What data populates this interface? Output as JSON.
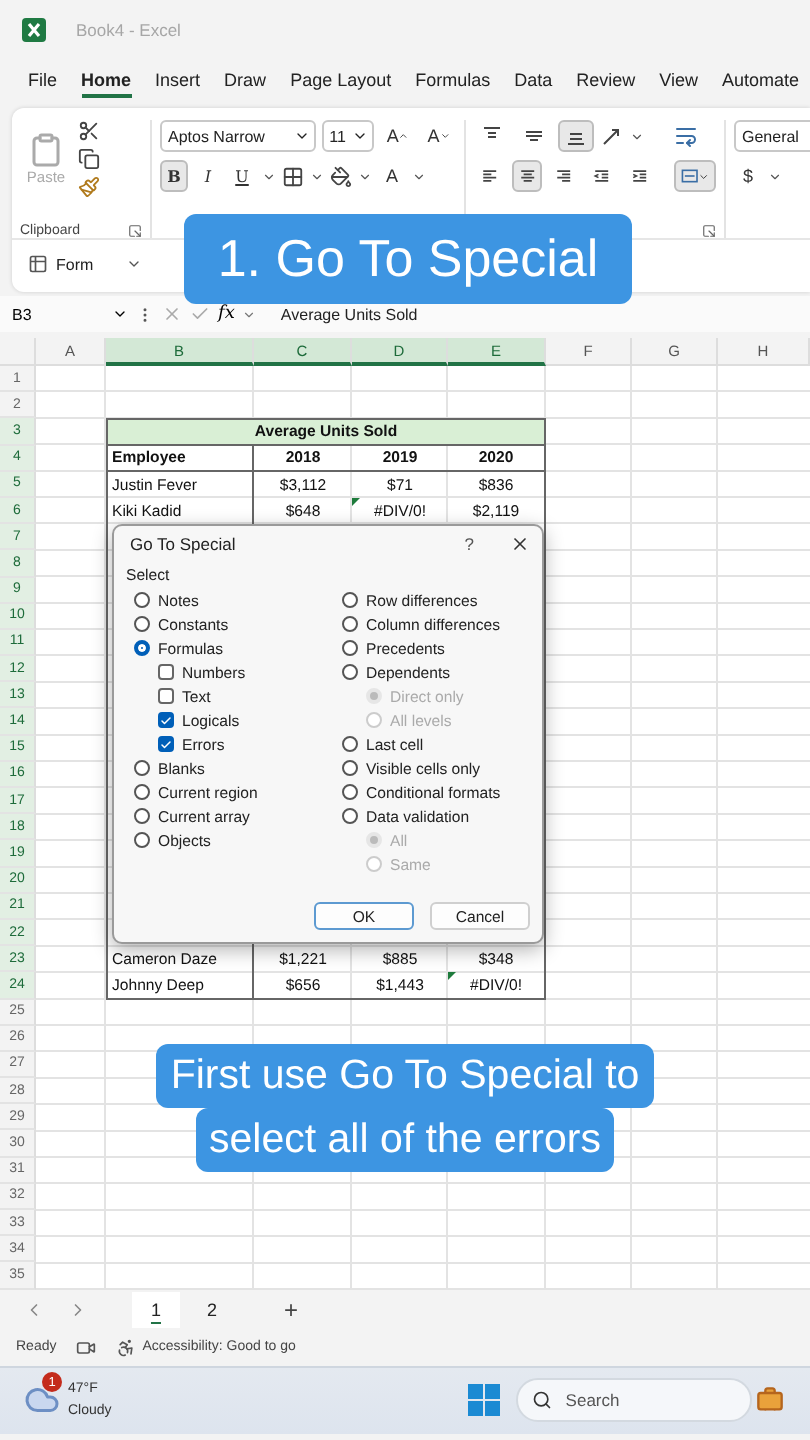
{
  "window": {
    "title": "Book4 - Excel"
  },
  "menu": [
    {
      "label": "File",
      "selected": false
    },
    {
      "label": "Home",
      "selected": true
    },
    {
      "label": "Insert",
      "selected": false
    },
    {
      "label": "Draw",
      "selected": false
    },
    {
      "label": "Page Layout",
      "selected": false
    },
    {
      "label": "Formulas",
      "selected": false
    },
    {
      "label": "Data",
      "selected": false
    },
    {
      "label": "Review",
      "selected": false
    },
    {
      "label": "View",
      "selected": false
    },
    {
      "label": "Automate",
      "selected": false
    }
  ],
  "ribbon": {
    "clipboard": {
      "paste": {
        "label": "Paste",
        "disabled": true
      },
      "group_label": "Clipboard"
    },
    "font": {
      "name": "Aptos Narrow",
      "size": "11",
      "grow": "A",
      "shrink": "A",
      "styles": [
        {
          "label": "B",
          "kind": "bold",
          "selected": true
        },
        {
          "label": "I",
          "kind": "italic",
          "selected": false
        },
        {
          "label": "U",
          "kind": "underline",
          "selected": false
        }
      ],
      "font_color": "A"
    },
    "alignment": {
      "vertical": [
        {
          "kind": "top",
          "selected": false
        },
        {
          "kind": "middle",
          "selected": false
        },
        {
          "kind": "bottom",
          "selected": true
        }
      ],
      "horizontal": [
        {
          "kind": "left",
          "selected": false
        },
        {
          "kind": "center",
          "selected": true
        },
        {
          "kind": "right",
          "selected": false
        },
        {
          "kind": "outdent",
          "selected": false
        },
        {
          "kind": "indent",
          "selected": false
        }
      ],
      "merge_selected": true
    },
    "number": {
      "format": "General",
      "currency": "$"
    }
  },
  "form_bar": {
    "label": "Form"
  },
  "banner_top": "1. Go To Special",
  "formula_bar": {
    "name_box": "B3",
    "fx": "fx",
    "formula": "Average Units Sold"
  },
  "grid": {
    "columns": [
      {
        "label": "A",
        "selected": false
      },
      {
        "label": "B",
        "selected": true
      },
      {
        "label": "C",
        "selected": true
      },
      {
        "label": "D",
        "selected": true
      },
      {
        "label": "E",
        "selected": true
      },
      {
        "label": "F",
        "selected": false
      },
      {
        "label": "G",
        "selected": false
      },
      {
        "label": "H",
        "selected": false
      }
    ],
    "rows": [
      {
        "number": "1",
        "selected": false,
        "kind": "empty"
      },
      {
        "number": "2",
        "selected": false,
        "kind": "empty"
      },
      {
        "number": "3",
        "selected": true,
        "kind": "title",
        "cells": [
          {
            "text": "Average Units Sold",
            "flagged": false
          }
        ]
      },
      {
        "number": "4",
        "selected": true,
        "kind": "header",
        "cells": [
          {
            "text": "Employee",
            "flagged": false
          },
          {
            "text": "2018",
            "flagged": false
          },
          {
            "text": "2019",
            "flagged": false
          },
          {
            "text": "2020",
            "flagged": false
          }
        ]
      },
      {
        "number": "5",
        "selected": true,
        "kind": "data",
        "cells": [
          {
            "text": "Justin Fever",
            "flagged": false
          },
          {
            "text": "$3,112",
            "flagged": false
          },
          {
            "text": "$71",
            "flagged": false
          },
          {
            "text": "$836",
            "flagged": false
          }
        ]
      },
      {
        "number": "6",
        "selected": true,
        "kind": "data",
        "cells": [
          {
            "text": "Kiki Kadid",
            "flagged": false
          },
          {
            "text": "$648",
            "flagged": false
          },
          {
            "text": "#DIV/0!",
            "flagged": true
          },
          {
            "text": "$2,119",
            "flagged": false
          }
        ]
      },
      {
        "number": "7",
        "selected": true,
        "kind": "covered"
      },
      {
        "number": "8",
        "selected": true,
        "kind": "covered"
      },
      {
        "number": "9",
        "selected": true,
        "kind": "covered"
      },
      {
        "number": "10",
        "selected": true,
        "kind": "covered"
      },
      {
        "number": "11",
        "selected": true,
        "kind": "covered"
      },
      {
        "number": "12",
        "selected": true,
        "kind": "covered"
      },
      {
        "number": "13",
        "selected": true,
        "kind": "covered"
      },
      {
        "number": "14",
        "selected": true,
        "kind": "covered"
      },
      {
        "number": "15",
        "selected": true,
        "kind": "covered"
      },
      {
        "number": "16",
        "selected": true,
        "kind": "covered"
      },
      {
        "number": "17",
        "selected": true,
        "kind": "covered"
      },
      {
        "number": "18",
        "selected": true,
        "kind": "covered"
      },
      {
        "number": "19",
        "selected": true,
        "kind": "covered"
      },
      {
        "number": "20",
        "selected": true,
        "kind": "covered"
      },
      {
        "number": "21",
        "selected": true,
        "kind": "covered"
      },
      {
        "number": "22",
        "selected": true,
        "kind": "covered"
      },
      {
        "number": "23",
        "selected": true,
        "kind": "data",
        "cells": [
          {
            "text": "Cameron Daze",
            "flagged": false
          },
          {
            "text": "$1,221",
            "flagged": false
          },
          {
            "text": "$885",
            "flagged": false
          },
          {
            "text": "$348",
            "flagged": false
          }
        ]
      },
      {
        "number": "24",
        "selected": true,
        "kind": "data",
        "cells": [
          {
            "text": "Johnny Deep",
            "flagged": false
          },
          {
            "text": "$656",
            "flagged": false
          },
          {
            "text": "$1,443",
            "flagged": false
          },
          {
            "text": "#DIV/0!",
            "flagged": true
          }
        ]
      },
      {
        "number": "25",
        "selected": false,
        "kind": "empty"
      },
      {
        "number": "26",
        "selected": false,
        "kind": "empty"
      },
      {
        "number": "27",
        "selected": false,
        "kind": "empty"
      },
      {
        "number": "28",
        "selected": false,
        "kind": "empty"
      },
      {
        "number": "29",
        "selected": false,
        "kind": "empty"
      },
      {
        "number": "30",
        "selected": false,
        "kind": "empty"
      },
      {
        "number": "31",
        "selected": false,
        "kind": "empty"
      },
      {
        "number": "32",
        "selected": false,
        "kind": "empty"
      },
      {
        "number": "33",
        "selected": false,
        "kind": "empty"
      },
      {
        "number": "34",
        "selected": false,
        "kind": "empty"
      },
      {
        "number": "35",
        "selected": false,
        "kind": "empty"
      }
    ]
  },
  "dialog": {
    "title": "Go To Special",
    "help": "?",
    "group_label": "Select",
    "left": [
      {
        "kind": "radio",
        "label": "Notes",
        "selected": false,
        "disabled": false
      },
      {
        "kind": "radio",
        "label": "Constants",
        "selected": false,
        "disabled": false
      },
      {
        "kind": "radio",
        "label": "Formulas",
        "selected": true,
        "disabled": false,
        "children": [
          {
            "kind": "checkbox",
            "label": "Numbers",
            "checked": false,
            "disabled": false
          },
          {
            "kind": "checkbox",
            "label": "Text",
            "checked": false,
            "disabled": false
          },
          {
            "kind": "checkbox",
            "label": "Logicals",
            "checked": true,
            "disabled": false
          },
          {
            "kind": "checkbox",
            "label": "Errors",
            "checked": true,
            "disabled": false
          }
        ]
      },
      {
        "kind": "radio",
        "label": "Blanks",
        "selected": false,
        "disabled": false
      },
      {
        "kind": "radio",
        "label": "Current region",
        "selected": false,
        "disabled": false
      },
      {
        "kind": "radio",
        "label": "Current array",
        "selected": false,
        "disabled": false
      },
      {
        "kind": "radio",
        "label": "Objects",
        "selected": false,
        "disabled": false
      }
    ],
    "right": [
      {
        "kind": "radio",
        "label": "Row differences",
        "selected": false,
        "disabled": false
      },
      {
        "kind": "radio",
        "label": "Column differences",
        "selected": false,
        "disabled": false
      },
      {
        "kind": "radio",
        "label": "Precedents",
        "selected": false,
        "disabled": false
      },
      {
        "kind": "radio",
        "label": "Dependents",
        "selected": false,
        "disabled": false,
        "children": [
          {
            "kind": "radio",
            "label": "Direct only",
            "selected": true,
            "disabled": true
          },
          {
            "kind": "radio",
            "label": "All levels",
            "selected": false,
            "disabled": true
          }
        ]
      },
      {
        "kind": "radio",
        "label": "Last cell",
        "selected": false,
        "disabled": false
      },
      {
        "kind": "radio",
        "label": "Visible cells only",
        "selected": false,
        "disabled": false
      },
      {
        "kind": "radio",
        "label": "Conditional formats",
        "selected": false,
        "disabled": false
      },
      {
        "kind": "radio",
        "label": "Data validation",
        "selected": false,
        "disabled": false,
        "children": [
          {
            "kind": "radio",
            "label": "All",
            "selected": true,
            "disabled": true
          },
          {
            "kind": "radio",
            "label": "Same",
            "selected": false,
            "disabled": true
          }
        ]
      }
    ],
    "buttons": [
      {
        "label": "OK",
        "kind": "default"
      },
      {
        "label": "Cancel",
        "kind": "normal"
      }
    ]
  },
  "banner_bottom": [
    "First use Go To Special to",
    "select all of the errors"
  ],
  "sheet_tabs": [
    {
      "label": "1",
      "selected": true
    },
    {
      "label": "2",
      "selected": false
    }
  ],
  "add_sheet": "+",
  "status_bar": {
    "ready": "Ready",
    "accessibility": "Accessibility: Good to go"
  },
  "taskbar": {
    "weather": {
      "badge": "1",
      "temperature": "47°F",
      "condition": "Cloudy"
    },
    "search": {
      "placeholder": "Search"
    }
  }
}
